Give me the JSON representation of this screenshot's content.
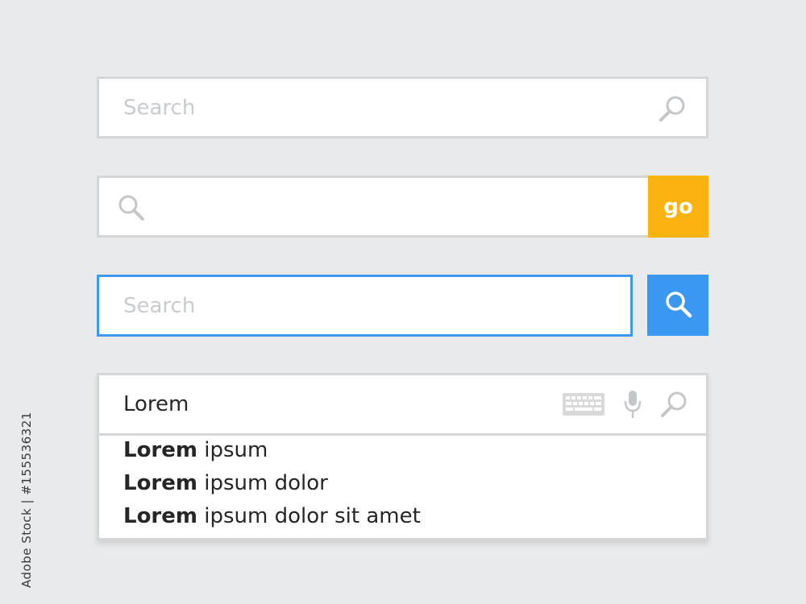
{
  "search_bar_1": {
    "placeholder": "Search",
    "icon": "search-icon"
  },
  "search_bar_2": {
    "icon": "search-icon",
    "go_label": "go",
    "go_color": "#fbb40f"
  },
  "search_bar_3": {
    "placeholder": "Search",
    "focus_color": "#3f98ee",
    "button_color": "#3b97f0",
    "button_icon": "search-icon"
  },
  "search_bar_4": {
    "value": "Lorem",
    "icons": [
      "keyboard-icon",
      "microphone-icon",
      "search-icon"
    ],
    "suggestions": [
      {
        "match": "Lorem",
        "rest": " ipsum"
      },
      {
        "match": "Lorem",
        "rest": " ipsum dolor"
      },
      {
        "match": "Lorem",
        "rest": " ipsum dolor sit amet"
      }
    ]
  },
  "side_text": "Adobe Stock | #155536321",
  "colors": {
    "background": "#e9eaeb",
    "border": "#d4d6d8",
    "placeholder": "#c9cccf",
    "text": "#262626"
  }
}
